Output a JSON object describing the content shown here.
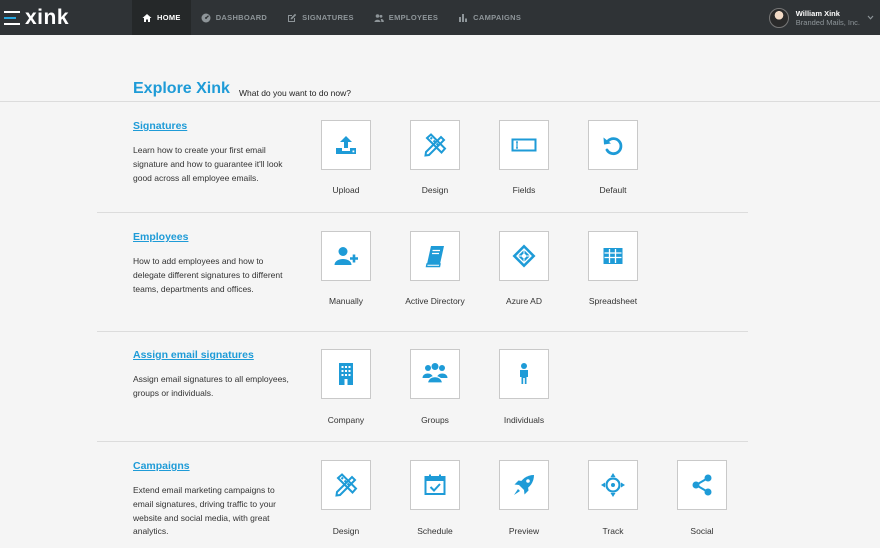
{
  "brand": {
    "logo_text": "xink"
  },
  "nav": [
    {
      "label": "HOME",
      "icon": "home-icon",
      "active": true
    },
    {
      "label": "DASHBOARD",
      "icon": "dashboard-icon"
    },
    {
      "label": "SIGNATURES",
      "icon": "edit-icon"
    },
    {
      "label": "EMPLOYEES",
      "icon": "users-icon"
    },
    {
      "label": "CAMPAIGNS",
      "icon": "bar-chart-icon"
    }
  ],
  "user": {
    "name": "William Xink",
    "company": "Branded Mails, Inc."
  },
  "page": {
    "title": "Explore Xink",
    "subtitle": "What do you want to do now?"
  },
  "sections": [
    {
      "title": "Signatures",
      "description": "Learn how to create your first email signature and how to guarantee it'll look good across all employee emails.",
      "tiles": [
        {
          "label": "Upload",
          "icon": "upload-icon"
        },
        {
          "label": "Design",
          "icon": "design-icon"
        },
        {
          "label": "Fields",
          "icon": "fields-icon"
        },
        {
          "label": "Default",
          "icon": "undo-icon"
        }
      ]
    },
    {
      "title": "Employees",
      "description": "How to add employees and how to delegate different signatures to different teams, departments and offices.",
      "tiles": [
        {
          "label": "Manually",
          "icon": "add-user-icon"
        },
        {
          "label": "Active Directory",
          "icon": "book-icon"
        },
        {
          "label": "Azure AD",
          "icon": "azure-icon"
        },
        {
          "label": "Spreadsheet",
          "icon": "table-icon"
        }
      ]
    },
    {
      "title": "Assign email signatures",
      "description": "Assign email signatures to all employees, groups or individuals.",
      "tiles": [
        {
          "label": "Company",
          "icon": "building-icon"
        },
        {
          "label": "Groups",
          "icon": "group-icon"
        },
        {
          "label": "Individuals",
          "icon": "person-icon"
        }
      ]
    },
    {
      "title": "Campaigns",
      "description": "Extend email marketing campaigns to email signatures, driving traffic to your website and social media, with great analytics.",
      "tiles": [
        {
          "label": "Design",
          "icon": "design-icon"
        },
        {
          "label": "Schedule",
          "icon": "calendar-icon"
        },
        {
          "label": "Preview",
          "icon": "rocket-icon"
        },
        {
          "label": "Track",
          "icon": "crosshair-icon"
        },
        {
          "label": "Social",
          "icon": "share-icon"
        }
      ]
    }
  ],
  "colors": {
    "accent": "#1e9bd7",
    "navbar": "#2f3336",
    "navbar_active": "#252829",
    "background": "#f5f5f5"
  }
}
